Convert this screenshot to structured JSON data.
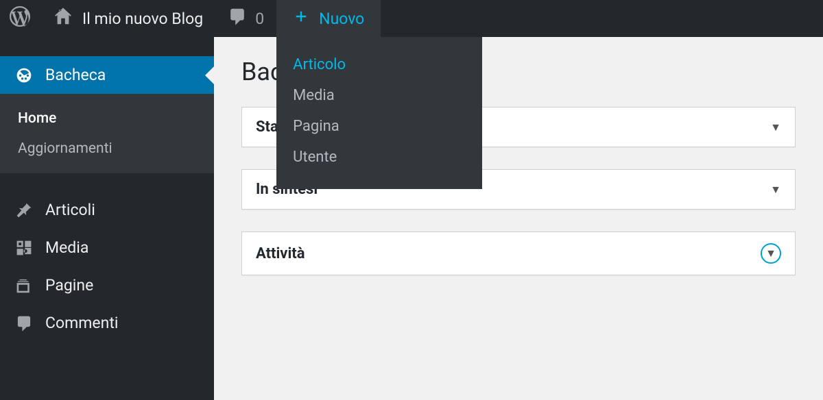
{
  "adminbar": {
    "site_name": "Il mio nuovo Blog",
    "comment_count": "0",
    "new_label": "Nuovo",
    "new_items": [
      "Articolo",
      "Media",
      "Pagina",
      "Utente"
    ]
  },
  "sidebar": {
    "dashboard": {
      "label": "Bacheca"
    },
    "dashboard_sub": {
      "home": "Home",
      "updates": "Aggiornamenti"
    },
    "items": [
      {
        "label": "Articoli",
        "icon": "pin"
      },
      {
        "label": "Media",
        "icon": "media"
      },
      {
        "label": "Pagine",
        "icon": "pages"
      },
      {
        "label": "Commenti",
        "icon": "comment"
      }
    ]
  },
  "main": {
    "page_title": "Bacheca",
    "panels": [
      {
        "title": "Stato di salute del sito"
      },
      {
        "title": "In sintesi"
      },
      {
        "title": "Attività"
      }
    ]
  }
}
